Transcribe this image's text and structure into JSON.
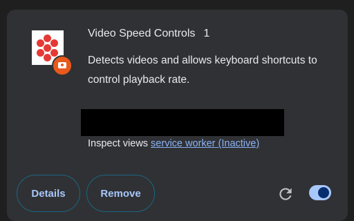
{
  "extension": {
    "name": "Video Speed Controls",
    "version": "1",
    "description": "Detects videos and allows keyboard shortcuts to control playback rate.",
    "icon": "video-speed-controls-logo",
    "badge_icon": "camera-icon",
    "badge_color": "#e8591c"
  },
  "inspect": {
    "label": "Inspect views",
    "link": "service worker (Inactive)"
  },
  "buttons": {
    "details": "Details",
    "remove": "Remove"
  },
  "controls": {
    "reload_icon": "reload-icon",
    "toggle_enabled": true,
    "accent": "#a8c7fa"
  }
}
